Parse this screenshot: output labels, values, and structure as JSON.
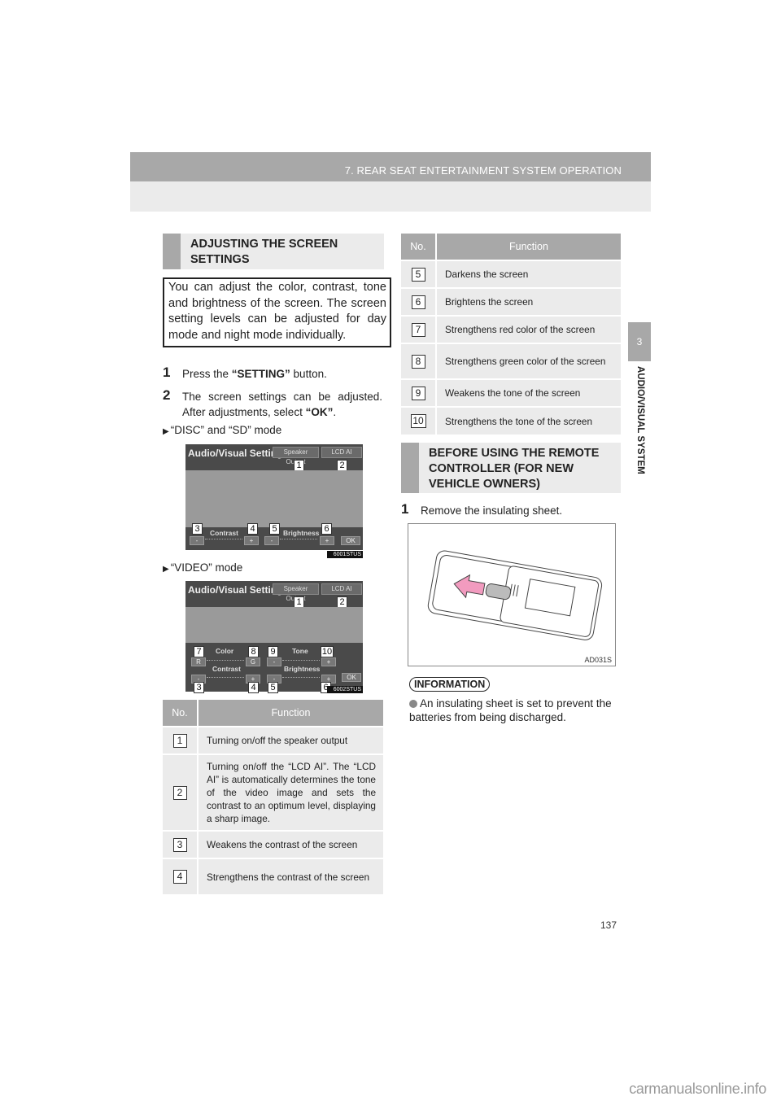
{
  "header": {
    "chapter_title": "7. REAR SEAT ENTERTAINMENT SYSTEM OPERATION"
  },
  "side_tab": {
    "number": "3",
    "label": "AUDIO/VISUAL SYSTEM"
  },
  "left": {
    "section_heading": "ADJUSTING THE SCREEN SETTINGS",
    "intro": "You can adjust the color, contrast, tone and brightness of the screen. The screen setting levels can be adjusted for day mode and night mode individually.",
    "steps": [
      {
        "n": "1",
        "pre": "Press the ",
        "bold": "“SETTING”",
        "post": " button."
      },
      {
        "n": "2",
        "pre": "The screen settings can be adjusted. After adjustments, select ",
        "bold": "“OK”",
        "post": "."
      }
    ],
    "mode_disc": "“DISC” and “SD” mode",
    "mode_video": "“VIDEO” mode",
    "screen1": {
      "title": "Audio/Visual Settings",
      "btn_speaker": "Speaker Output",
      "btn_lcd": "LCD AI",
      "contrast": "Contrast",
      "brightness": "Brightness",
      "minus": "-",
      "plus": "+",
      "ok": "OK",
      "code": "6001STUS",
      "callouts": [
        "1",
        "2",
        "3",
        "4",
        "5",
        "6"
      ]
    },
    "screen2": {
      "title": "Audio/Visual Settings",
      "btn_speaker": "Speaker Output",
      "btn_lcd": "LCD AI",
      "color": "Color",
      "tone": "Tone",
      "contrast": "Contrast",
      "brightness": "Brightness",
      "r": "R",
      "g": "G",
      "minus": "-",
      "plus": "+",
      "ok": "OK",
      "code": "6002STUS",
      "callouts": [
        "1",
        "2",
        "3",
        "4",
        "5",
        "6",
        "7",
        "8",
        "9",
        "10"
      ]
    },
    "table": {
      "headers": [
        "No.",
        "Function"
      ],
      "rows": [
        {
          "no": "1",
          "fn": "Turning on/off the speaker output"
        },
        {
          "no": "2",
          "fn": "Turning on/off the “LCD AI”. The “LCD AI” is automatically determines the tone of the video image and sets the contrast to an optimum level, displaying a sharp image."
        },
        {
          "no": "3",
          "fn": "Weakens the contrast of the screen"
        },
        {
          "no": "4",
          "fn": "Strengthens the contrast of the screen"
        }
      ]
    }
  },
  "right": {
    "table": {
      "headers": [
        "No.",
        "Function"
      ],
      "rows": [
        {
          "no": "5",
          "fn": "Darkens the screen"
        },
        {
          "no": "6",
          "fn": "Brightens the screen"
        },
        {
          "no": "7",
          "fn": "Strengthens red color of the screen"
        },
        {
          "no": "8",
          "fn": "Strengthens green color of the screen"
        },
        {
          "no": "9",
          "fn": "Weakens the tone of the screen"
        },
        {
          "no": "10",
          "fn": "Strengthens the tone of the screen"
        }
      ]
    },
    "section_heading": "BEFORE USING THE REMOTE CONTROLLER (FOR NEW VEHICLE OWNERS)",
    "step": {
      "n": "1",
      "text": "Remove the insulating sheet."
    },
    "figure_code": "AD031S",
    "info_label": "INFORMATION",
    "info_text": "An insulating sheet is set to prevent the batteries from being discharged."
  },
  "page_number": "137",
  "watermark": "carmanualsonline.info",
  "colors": {
    "header_gray": "#a8a8a8",
    "panel_gray": "#ebebeb",
    "arrow_pink": "#f29bbf"
  }
}
